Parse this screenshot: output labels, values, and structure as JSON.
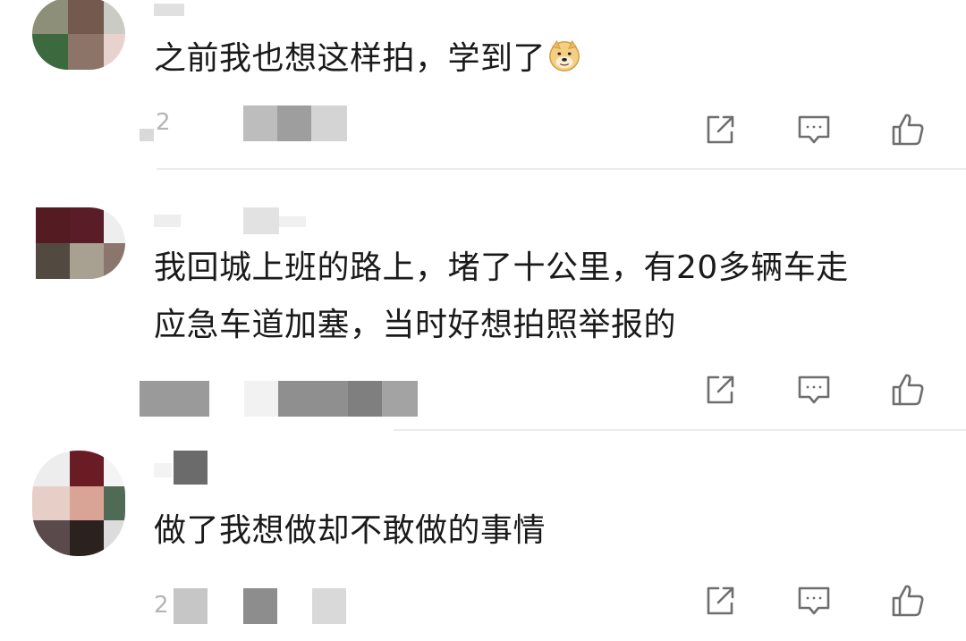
{
  "comments": [
    {
      "text": "之前我也想这样拍，学到了",
      "emoji": "doge-emoji",
      "meta_fragment": "2",
      "actions": {
        "share": "share-icon",
        "reply": "comment-icon",
        "like": "thumbs-up-icon"
      }
    },
    {
      "text_line1": "我回城上班的路上，堵了十公里，有20多辆车走",
      "text_line2": "应急车道加塞，当时好想拍照举报的",
      "actions": {
        "share": "share-icon",
        "reply": "comment-icon",
        "like": "thumbs-up-icon"
      }
    },
    {
      "text": "做了我想做却不敢做的事情",
      "meta_fragment": "2",
      "actions": {
        "share": "share-icon",
        "reply": "comment-icon",
        "like": "thumbs-up-icon"
      }
    }
  ],
  "colors": {
    "icon": "#6e6e6e",
    "divider": "#ececec",
    "text": "#1a1a1a",
    "blur_dark": "#7a7a7a",
    "blur_mid": "#a8a8a8",
    "blur_light": "#d6d6d6"
  }
}
